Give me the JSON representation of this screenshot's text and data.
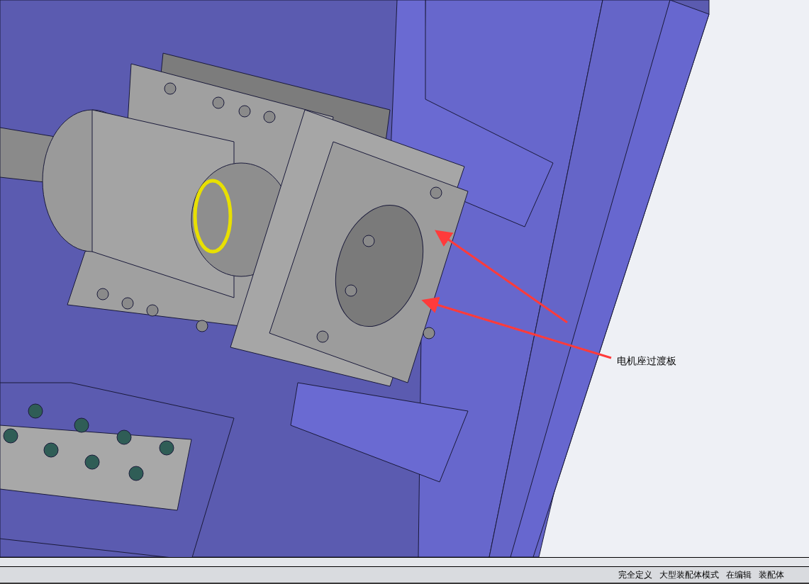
{
  "viewport": {
    "callout": {
      "label": "电机座过渡板"
    }
  },
  "status_bar": {
    "items": [
      "完全定义",
      "大型装配体模式",
      "在编辑",
      "装配体"
    ]
  }
}
